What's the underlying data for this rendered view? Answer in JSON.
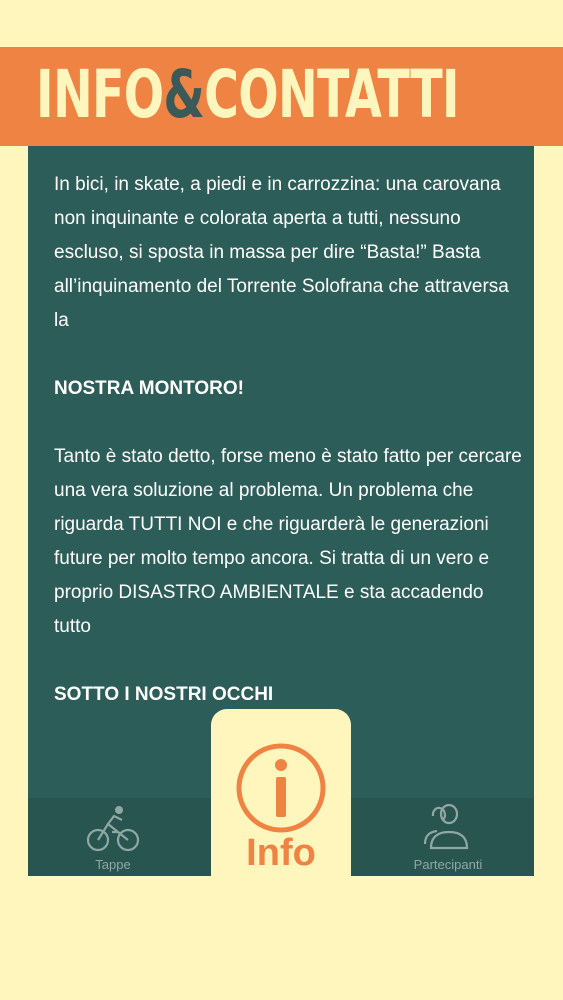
{
  "header": {
    "title_part1": "INFO",
    "title_amp": "&",
    "title_part2": "CONTATTI"
  },
  "content": {
    "paragraph1": "In bici, in skate, a piedi e in carrozzina: una carovana non inquinante e colorata aperta a tutti, nessuno escluso, si sposta in massa per dire “Basta!” Basta all’inquinamento del Torrente Solofrana che attraversa la",
    "heading1": "NOSTRA MONTORO!",
    "paragraph2": "Tanto è stato detto, forse meno è stato fatto per cercare una vera soluzione al problema. Un problema che riguarda TUTTI NOI e che riguarderà le generazioni future per molto tempo ancora. Si tratta di un vero e proprio DISASTRO AMBIENTALE e sta accadendo tutto",
    "heading2": "SOTTO I NOSTRI OCCHI"
  },
  "tabbar": {
    "tabs": [
      {
        "label": "Tappe",
        "icon": "cyclist-icon"
      },
      {
        "label": "Info",
        "icon": "info-icon",
        "active": true
      },
      {
        "label": "Partecipanti",
        "icon": "people-icon"
      }
    ]
  },
  "colors": {
    "background": "#fff6bd",
    "accent": "#ef8343",
    "panel": "#2c5d58",
    "inactive_tab": "#8fa8a3"
  }
}
